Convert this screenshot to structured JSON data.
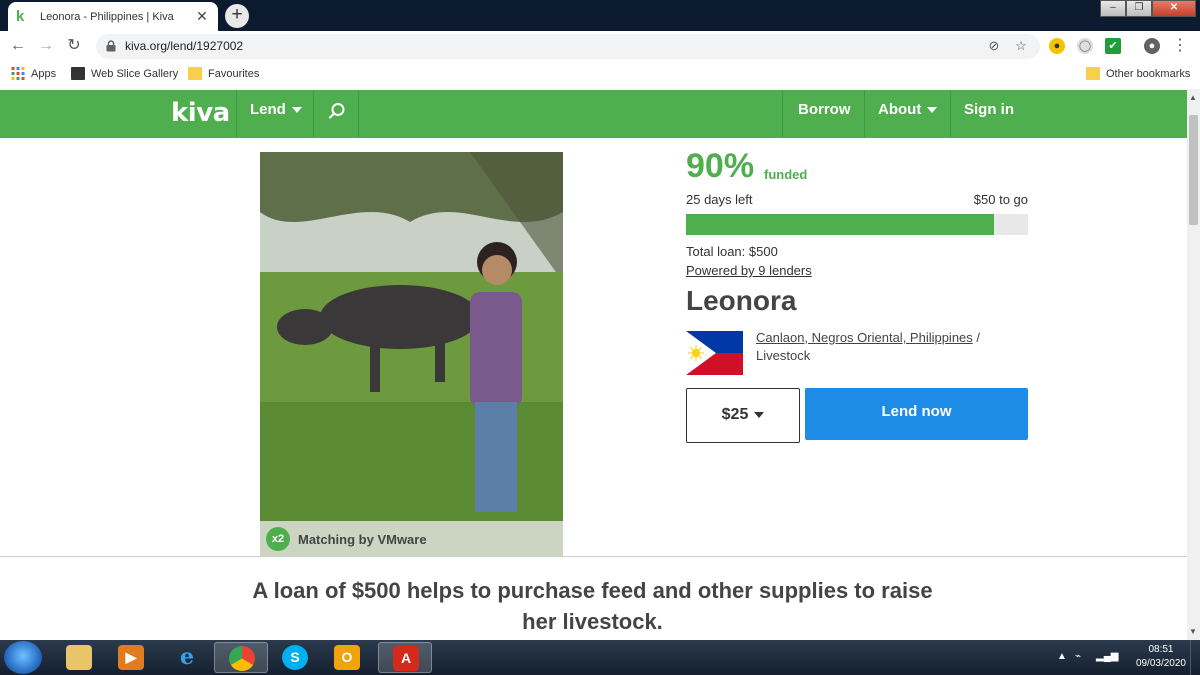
{
  "browser": {
    "tab_title": "Leonora - Philippines | Kiva",
    "new_tab": "+",
    "url": "kiva.org/lend/1927002",
    "bookmarks": [
      {
        "label": "Apps"
      },
      {
        "label": "Web Slice Gallery"
      },
      {
        "label": "Favourites"
      }
    ],
    "other_bookmarks": "Other bookmarks"
  },
  "nav": {
    "logo": "kiva",
    "lend": "Lend",
    "borrow": "Borrow",
    "about": "About",
    "sign_in": "Sign in"
  },
  "loan": {
    "funded_percent": "90%",
    "funded_label": "funded",
    "progress_fraction": 0.9,
    "days_left": "25 days left",
    "to_go": "$50 to go",
    "total_loan": "Total loan: $500",
    "powered_by": "Powered by 9 lenders",
    "borrower_name": "Leonora",
    "location": "Canlaon, Negros Oriental, Philippines",
    "location_sep": " /",
    "sector": "Livestock",
    "amount": "$25",
    "lend_button": "Lend now",
    "matching_badge": "x2",
    "matching": "Matching by VMware",
    "description": "A loan of $500 helps to purchase feed and other supplies to raise her livestock."
  },
  "taskbar": {
    "time": "08:51",
    "date": "09/03/2020"
  },
  "colors": {
    "kiva_green": "#4faf4e",
    "lend_blue": "#1c8ce6"
  }
}
